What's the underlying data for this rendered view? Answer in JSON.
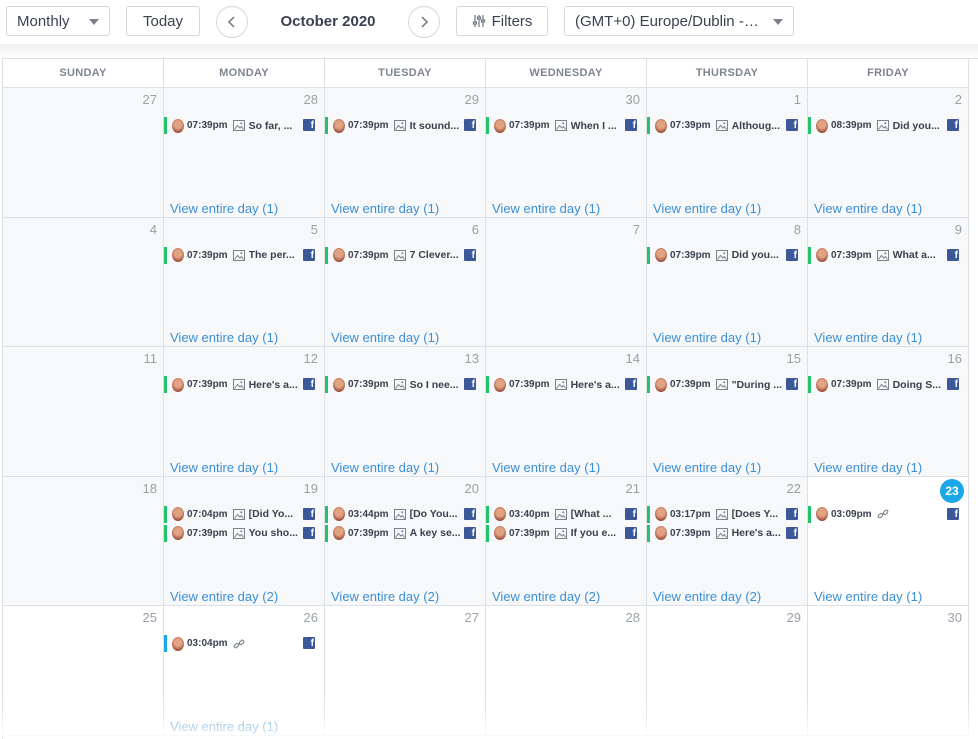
{
  "toolbar": {
    "view_mode": "Monthly",
    "today_label": "Today",
    "month_title": "October 2020",
    "filters_label": "Filters",
    "timezone": "(GMT+0) Europe/Dublin - G..."
  },
  "colors": {
    "published_bar": "#21c46a",
    "scheduled_bar": "#1ba8e8",
    "today_badge": "#1ba8e8",
    "facebook": "#3b5998",
    "link": "#3b8fd6"
  },
  "calendar": {
    "weekdays": [
      "SUNDAY",
      "MONDAY",
      "TUESDAY",
      "WEDNESDAY",
      "THURSDAY",
      "FRIDAY"
    ],
    "weeks": [
      {
        "days": [
          {
            "num": "27",
            "posts": [],
            "view": ""
          },
          {
            "num": "28",
            "posts": [
              {
                "time": "07:39pm",
                "media": "image-icon",
                "title": "So far, ..."
              }
            ],
            "view": "View entire day (1)"
          },
          {
            "num": "29",
            "posts": [
              {
                "time": "07:39pm",
                "media": "image-icon",
                "title": "It sound..."
              }
            ],
            "view": "View entire day (1)"
          },
          {
            "num": "30",
            "posts": [
              {
                "time": "07:39pm",
                "media": "image-icon",
                "title": "When I ..."
              }
            ],
            "view": "View entire day (1)"
          },
          {
            "num": "1",
            "posts": [
              {
                "time": "07:39pm",
                "media": "image-icon",
                "title": "Althoug..."
              }
            ],
            "view": "View entire day (1)"
          },
          {
            "num": "2",
            "posts": [
              {
                "time": "08:39pm",
                "media": "image-icon",
                "title": "Did you..."
              }
            ],
            "view": "View entire day (1)"
          }
        ]
      },
      {
        "days": [
          {
            "num": "4",
            "posts": [],
            "view": ""
          },
          {
            "num": "5",
            "posts": [
              {
                "time": "07:39pm",
                "media": "image-icon",
                "title": "The per..."
              }
            ],
            "view": "View entire day (1)"
          },
          {
            "num": "6",
            "posts": [
              {
                "time": "07:39pm",
                "media": "image-icon",
                "title": "7 Clever..."
              }
            ],
            "view": "View entire day (1)"
          },
          {
            "num": "7",
            "posts": [],
            "view": ""
          },
          {
            "num": "8",
            "posts": [
              {
                "time": "07:39pm",
                "media": "image-icon",
                "title": "Did you..."
              }
            ],
            "view": "View entire day (1)"
          },
          {
            "num": "9",
            "posts": [
              {
                "time": "07:39pm",
                "media": "image-icon",
                "title": "What a..."
              }
            ],
            "view": "View entire day (1)"
          }
        ]
      },
      {
        "days": [
          {
            "num": "11",
            "posts": [],
            "view": ""
          },
          {
            "num": "12",
            "posts": [
              {
                "time": "07:39pm",
                "media": "image-icon",
                "title": "Here's a..."
              }
            ],
            "view": "View entire day (1)"
          },
          {
            "num": "13",
            "posts": [
              {
                "time": "07:39pm",
                "media": "image-icon",
                "title": "So I nee..."
              }
            ],
            "view": "View entire day (1)"
          },
          {
            "num": "14",
            "posts": [
              {
                "time": "07:39pm",
                "media": "image-icon",
                "title": "Here's a..."
              }
            ],
            "view": "View entire day (1)"
          },
          {
            "num": "15",
            "posts": [
              {
                "time": "07:39pm",
                "media": "image-icon",
                "title": "\"During ..."
              }
            ],
            "view": "View entire day (1)"
          },
          {
            "num": "16",
            "posts": [
              {
                "time": "07:39pm",
                "media": "image-icon",
                "title": "Doing S..."
              }
            ],
            "view": "View entire day (1)"
          }
        ]
      },
      {
        "days": [
          {
            "num": "18",
            "posts": [],
            "view": ""
          },
          {
            "num": "19",
            "posts": [
              {
                "time": "07:04pm",
                "media": "image-icon",
                "title": "[Did Yo..."
              },
              {
                "time": "07:39pm",
                "media": "image-icon",
                "title": "You sho..."
              }
            ],
            "view": "View entire day (2)"
          },
          {
            "num": "20",
            "posts": [
              {
                "time": "03:44pm",
                "media": "image-icon",
                "title": "[Do You..."
              },
              {
                "time": "07:39pm",
                "media": "image-icon",
                "title": "A key se..."
              }
            ],
            "view": "View entire day (2)"
          },
          {
            "num": "21",
            "posts": [
              {
                "time": "03:40pm",
                "media": "image-icon",
                "title": "[What ..."
              },
              {
                "time": "07:39pm",
                "media": "image-icon",
                "title": "If you e..."
              }
            ],
            "view": "View entire day (2)"
          },
          {
            "num": "22",
            "posts": [
              {
                "time": "03:17pm",
                "media": "image-icon",
                "title": "[Does Y..."
              },
              {
                "time": "07:39pm",
                "media": "image-icon",
                "title": "Here's a..."
              }
            ],
            "view": "View entire day (2)"
          },
          {
            "num": "23",
            "posts": [
              {
                "time": "03:09pm",
                "media": "link-icon",
                "title": ""
              }
            ],
            "view": "View entire day (1)",
            "today": true
          }
        ]
      },
      {
        "days": [
          {
            "num": "25",
            "posts": [],
            "view": ""
          },
          {
            "num": "26",
            "posts": [
              {
                "time": "03:04pm",
                "media": "link-icon",
                "title": ""
              }
            ],
            "view": "View entire day (1)"
          },
          {
            "num": "27",
            "posts": [],
            "view": ""
          },
          {
            "num": "28",
            "posts": [],
            "view": ""
          },
          {
            "num": "29",
            "posts": [],
            "view": ""
          },
          {
            "num": "30",
            "posts": [],
            "view": ""
          }
        ]
      }
    ]
  }
}
